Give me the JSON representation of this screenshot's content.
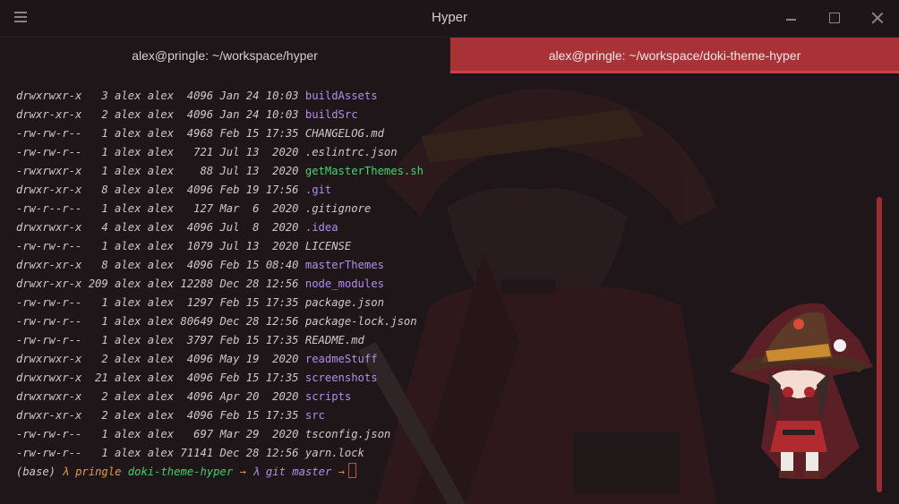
{
  "window": {
    "title": "Hyper"
  },
  "tabs": [
    {
      "label": "alex@pringle: ~/workspace/hyper",
      "active": false
    },
    {
      "label": "alex@pringle: ~/workspace/doki-theme-hyper",
      "active": true
    }
  ],
  "colors": {
    "accent": "#a83236",
    "directory": "#b28ee8",
    "executable": "#43d66f",
    "background": "#1f1619"
  },
  "listing": [
    {
      "meta": "drwxrwxr-x   3 alex alex  4096 Jan 24 10:03 ",
      "name": "buildAssets",
      "kind": "dir"
    },
    {
      "meta": "drwxr-xr-x   2 alex alex  4096 Jan 24 10:03 ",
      "name": "buildSrc",
      "kind": "dir"
    },
    {
      "meta": "-rw-rw-r--   1 alex alex  4968 Feb 15 17:35 ",
      "name": "CHANGELOG.md",
      "kind": "file"
    },
    {
      "meta": "-rw-rw-r--   1 alex alex   721 Jul 13  2020 ",
      "name": ".eslintrc.json",
      "kind": "file"
    },
    {
      "meta": "-rwxrwxr-x   1 alex alex    88 Jul 13  2020 ",
      "name": "getMasterThemes.sh",
      "kind": "exec"
    },
    {
      "meta": "drwxr-xr-x   8 alex alex  4096 Feb 19 17:56 ",
      "name": ".git",
      "kind": "dir"
    },
    {
      "meta": "-rw-r--r--   1 alex alex   127 Mar  6  2020 ",
      "name": ".gitignore",
      "kind": "file"
    },
    {
      "meta": "drwxrwxr-x   4 alex alex  4096 Jul  8  2020 ",
      "name": ".idea",
      "kind": "dir"
    },
    {
      "meta": "-rw-rw-r--   1 alex alex  1079 Jul 13  2020 ",
      "name": "LICENSE",
      "kind": "file"
    },
    {
      "meta": "drwxr-xr-x   8 alex alex  4096 Feb 15 08:40 ",
      "name": "masterThemes",
      "kind": "dir"
    },
    {
      "meta": "drwxr-xr-x 209 alex alex 12288 Dec 28 12:56 ",
      "name": "node_modules",
      "kind": "dir"
    },
    {
      "meta": "-rw-rw-r--   1 alex alex  1297 Feb 15 17:35 ",
      "name": "package.json",
      "kind": "file"
    },
    {
      "meta": "-rw-rw-r--   1 alex alex 80649 Dec 28 12:56 ",
      "name": "package-lock.json",
      "kind": "file"
    },
    {
      "meta": "-rw-rw-r--   1 alex alex  3797 Feb 15 17:35 ",
      "name": "README.md",
      "kind": "file"
    },
    {
      "meta": "drwxrwxr-x   2 alex alex  4096 May 19  2020 ",
      "name": "readmeStuff",
      "kind": "dir"
    },
    {
      "meta": "drwxrwxr-x  21 alex alex  4096 Feb 15 17:35 ",
      "name": "screenshots",
      "kind": "dir"
    },
    {
      "meta": "drwxrwxr-x   2 alex alex  4096 Apr 20  2020 ",
      "name": "scripts",
      "kind": "dir"
    },
    {
      "meta": "drwxr-xr-x   2 alex alex  4096 Feb 15 17:35 ",
      "name": "src",
      "kind": "dir"
    },
    {
      "meta": "-rw-rw-r--   1 alex alex   697 Mar 29  2020 ",
      "name": "tsconfig.json",
      "kind": "file"
    },
    {
      "meta": "-rw-rw-r--   1 alex alex 71141 Dec 28 12:56 ",
      "name": "yarn.lock",
      "kind": "file"
    }
  ],
  "prompt": {
    "env": "(base)",
    "lambda": "λ",
    "host": "pringle",
    "dir": "doki-theme-hyper",
    "arrow": "→",
    "git_lambda": "λ",
    "git_label": "git",
    "branch": "master",
    "arrow2": "→"
  }
}
